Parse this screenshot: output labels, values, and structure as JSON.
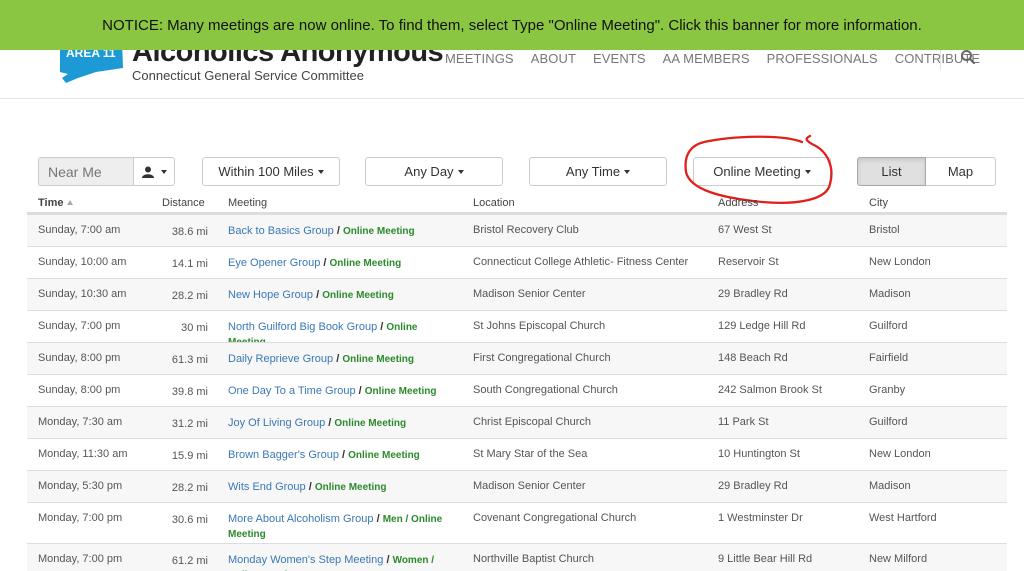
{
  "banner": {
    "text": "NOTICE: Many meetings are now online. To find them, select Type \"Online Meeting\". Click this banner for more information."
  },
  "site": {
    "logo_title": "Alcoholics Anonymous",
    "logo_subtitle": "Connecticut General Service Committee",
    "logo_badge": "AREA 11"
  },
  "nav": {
    "items": [
      "MEETINGS",
      "ABOUT",
      "EVENTS",
      "AA MEMBERS",
      "PROFESSIONALS",
      "CONTRIBUTE"
    ]
  },
  "filters": {
    "near_me_placeholder": "Near Me",
    "distance": "Within 100 Miles",
    "day": "Any Day",
    "time": "Any Time",
    "type": "Online Meeting",
    "view_list": "List",
    "view_map": "Map"
  },
  "table": {
    "headers": {
      "time": "Time",
      "distance": "Distance",
      "meeting": "Meeting",
      "location": "Location",
      "address": "Address",
      "city": "City"
    },
    "rows": [
      {
        "time": "Sunday, 7:00 am",
        "distance": "38.6 mi",
        "meeting": "Back to Basics Group",
        "types": "Online Meeting",
        "location": "Bristol Recovery Club",
        "address": "67 West St",
        "city": "Bristol"
      },
      {
        "time": "Sunday, 10:00 am",
        "distance": "14.1 mi",
        "meeting": "Eye Opener Group",
        "types": "Online Meeting",
        "location": "Connecticut College Athletic- Fitness Center",
        "address": "Reservoir St",
        "city": "New London"
      },
      {
        "time": "Sunday, 10:30 am",
        "distance": "28.2 mi",
        "meeting": "New Hope Group",
        "types": "Online Meeting",
        "location": "Madison Senior Center",
        "address": "29 Bradley Rd",
        "city": "Madison"
      },
      {
        "time": "Sunday, 7:00 pm",
        "distance": "30 mi",
        "meeting": "North Guilford Big Book Group",
        "types": "Online Meeting",
        "location": "St Johns Episcopal Church",
        "address": "129 Ledge Hill Rd",
        "city": "Guilford"
      },
      {
        "time": "Sunday, 8:00 pm",
        "distance": "61.3 mi",
        "meeting": "Daily Reprieve Group",
        "types": "Online Meeting",
        "location": "First Congregational Church",
        "address": "148 Beach Rd",
        "city": "Fairfield"
      },
      {
        "time": "Sunday, 8:00 pm",
        "distance": "39.8 mi",
        "meeting": "One Day To a Time Group",
        "types": "Online Meeting",
        "location": "South Congregational Church",
        "address": "242 Salmon Brook St",
        "city": "Granby"
      },
      {
        "time": "Monday, 7:30 am",
        "distance": "31.2 mi",
        "meeting": "Joy Of Living Group",
        "types": "Online Meeting",
        "location": "Christ Episcopal Church",
        "address": "11 Park St",
        "city": "Guilford"
      },
      {
        "time": "Monday, 11:30 am",
        "distance": "15.9 mi",
        "meeting": "Brown Bagger's Group",
        "types": "Online Meeting",
        "location": "St Mary Star of the Sea",
        "address": "10 Huntington St",
        "city": "New London"
      },
      {
        "time": "Monday, 5:30 pm",
        "distance": "28.2 mi",
        "meeting": "Wits End Group",
        "types": "Online Meeting",
        "location": "Madison Senior Center",
        "address": "29 Bradley Rd",
        "city": "Madison"
      },
      {
        "time": "Monday, 7:00 pm",
        "distance": "30.6 mi",
        "meeting": "More About Alcoholism Group",
        "types": "Men / Online Meeting",
        "location": "Covenant Congregational Church",
        "address": "1 Westminster Dr",
        "city": "West Hartford"
      },
      {
        "time": "Monday, 7:00 pm",
        "distance": "61.2 mi",
        "meeting": "Monday Women's Step Meeting",
        "types": "Women / Online Meeting",
        "location": "Northville Baptist Church",
        "address": "9 Little Bear Hill Rd",
        "city": "New Milford"
      }
    ]
  },
  "colors": {
    "banner": "#8ac642",
    "link": "#3a78b5",
    "type_tag": "#2b8a2b",
    "annotation": "#e0201b"
  }
}
